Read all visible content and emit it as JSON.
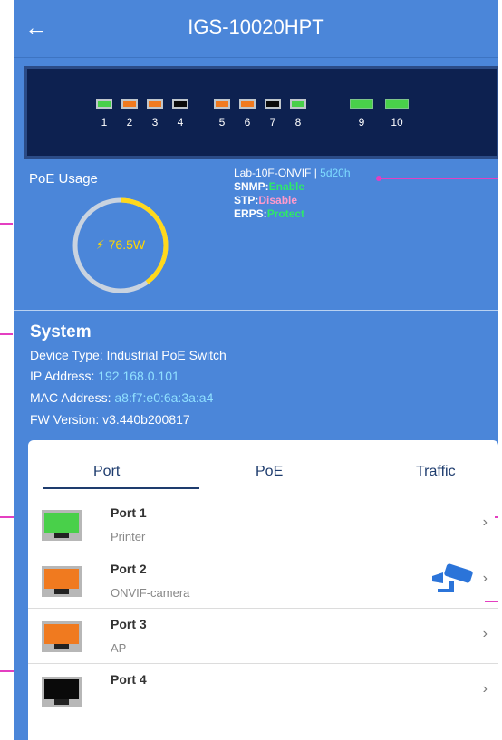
{
  "header": {
    "title": "IGS-10020HPT",
    "back_icon": "arrow-left-icon"
  },
  "switch_panel": {
    "ports": [
      {
        "num": "1",
        "color": "#49d04a"
      },
      {
        "num": "2",
        "color": "#f07a1f"
      },
      {
        "num": "3",
        "color": "#f07a1f"
      },
      {
        "num": "4",
        "color": "#0a0a0a"
      },
      {
        "num": "5",
        "color": "#f07a1f"
      },
      {
        "num": "6",
        "color": "#f07a1f"
      },
      {
        "num": "7",
        "color": "#0a0a0a"
      },
      {
        "num": "8",
        "color": "#49d04a"
      }
    ],
    "sfp_ports": [
      {
        "num": "9",
        "color": "#49d04a"
      },
      {
        "num": "10",
        "color": "#49d04a"
      }
    ]
  },
  "poe": {
    "label": "PoE Usage",
    "value": "76.5W",
    "gauge_fraction": 0.4
  },
  "status": {
    "name": "Lab-10F-ONVIF",
    "separator": " | ",
    "uptime": "5d20h",
    "snmp_label": "SNMP:",
    "snmp_value": "Enable",
    "stp_label": "STP:",
    "stp_value": "Disable",
    "erps_label": "ERPS:",
    "erps_value": "Protect"
  },
  "system": {
    "title": "System",
    "device_type": "Device Type: Industrial PoE Switch",
    "ip_label": "IP Address: ",
    "ip_value": "192.168.0.101",
    "mac_label": "MAC Address: ",
    "mac_value": "a8:f7:e0:6a:3a:a4",
    "fw_label": "FW Version:  ",
    "fw_value": "v3.440b200817"
  },
  "tabs": [
    "Port",
    "PoE",
    "Traffic"
  ],
  "ports_list": [
    {
      "name": "Port 1",
      "desc": "Printer",
      "color": "#49d04a"
    },
    {
      "name": "Port 2",
      "desc": "ONVIF-camera",
      "color": "#f07a1f"
    },
    {
      "name": "Port 3",
      "desc": "AP",
      "color": "#f07a1f"
    },
    {
      "name": "Port 4",
      "desc": "",
      "color": "#0a0a0a"
    }
  ]
}
